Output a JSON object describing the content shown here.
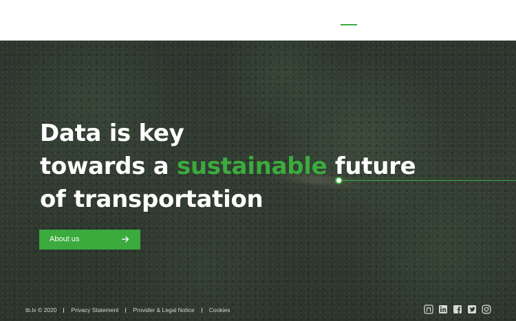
{
  "hero": {
    "title_line1": "Data is key",
    "title_line2_before": "towards a ",
    "title_line2_accent": "sustainable",
    "title_line2_after": " future",
    "title_line3": "of transportation",
    "cta_label": "About us"
  },
  "footer": {
    "copyright": "tb.lx © 2020",
    "links": [
      "Privacy Statement",
      "Provider & Legal Notice",
      "Cookies"
    ],
    "social_icons": [
      "github-icon",
      "linkedin-icon",
      "facebook-icon",
      "twitter-icon",
      "instagram-icon"
    ]
  },
  "colors": {
    "accent": "#3bab3e",
    "hero_text": "#ffffff",
    "footer_text": "#d6d9d6",
    "header_bg": "#ffffff"
  }
}
